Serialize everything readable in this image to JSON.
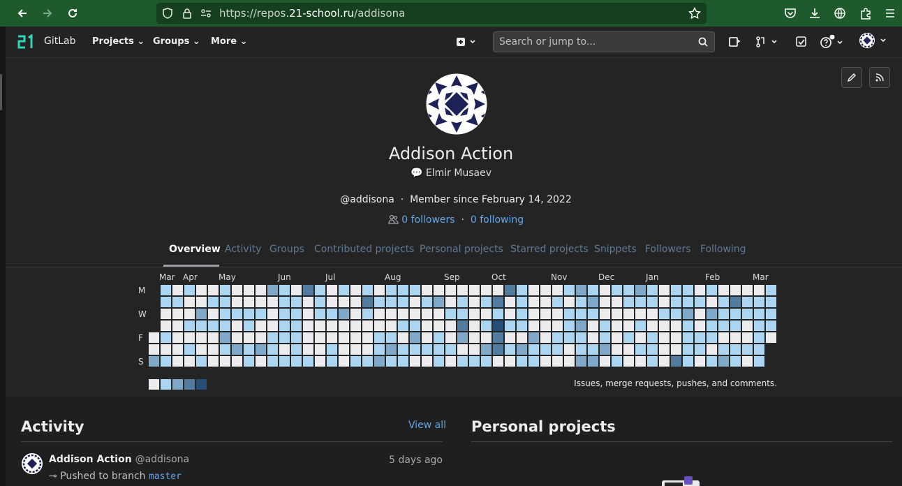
{
  "browser": {
    "url_prefix": "https://repos.",
    "url_domain": "21-school.ru",
    "url_path": "/addisona"
  },
  "nav": {
    "brand": "GitLab",
    "projects": "Projects",
    "groups": "Groups",
    "more": "More",
    "search_placeholder": "Search or jump to..."
  },
  "profile": {
    "name": "Addison Action",
    "status": "Elmir Musaev",
    "handle": "@addisona",
    "member_since": "Member since February 14, 2022",
    "followers": "0 followers",
    "following": "0 following"
  },
  "tabs": [
    "Overview",
    "Activity",
    "Groups",
    "Contributed projects",
    "Personal projects",
    "Starred projects",
    "Snippets",
    "Followers",
    "Following"
  ],
  "calendar": {
    "months": [
      "Mar",
      "Apr",
      "May",
      "Jun",
      "Jul",
      "Aug",
      "Sep",
      "Oct",
      "Nov",
      "Dec",
      "Jan",
      "Feb",
      "Mar"
    ],
    "day_labels": [
      "M",
      "W",
      "F",
      "S"
    ],
    "caption": "Issues, merge requests, pushes, and comments.",
    "legend_colors": [
      "#ececef",
      "#acd5f2",
      "#7fa8c9",
      "#527ba0",
      "#254e77"
    ]
  },
  "activity": {
    "title": "Activity",
    "view_all": "View all",
    "events": [
      {
        "author": "Addison Action",
        "handle": "@addisona",
        "time": "5 days ago",
        "action": "Pushed to branch",
        "branch": "master"
      }
    ]
  },
  "personal_projects": {
    "title": "Personal projects"
  },
  "colors": {
    "link": "#63a6e9",
    "browser_bar": "#1e5a2b",
    "accent_brand": "#2fd6b3"
  }
}
